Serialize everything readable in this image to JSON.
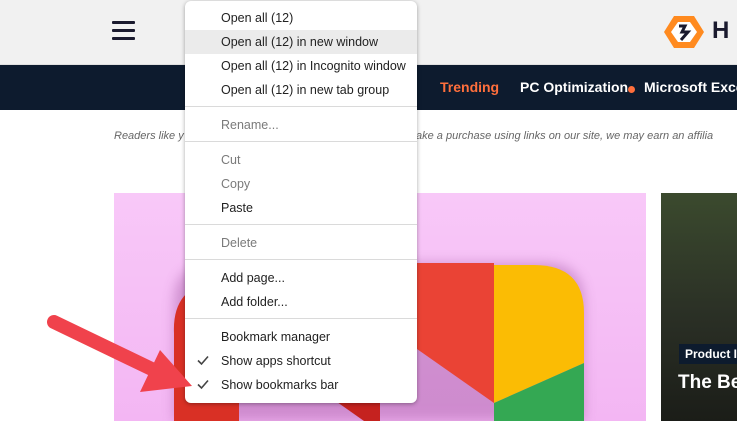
{
  "site": {
    "logo_text": "H",
    "nav": {
      "trending": "Trending",
      "pc_optimization": "PC Optimization",
      "microsoft_excel": "Microsoft Exce"
    },
    "disclaimer_left": "Readers like y",
    "disclaimer_right": "ake a purchase using links on our site, we may earn an affilia",
    "side_card": {
      "badge": "Product I",
      "title": "The Be"
    }
  },
  "context_menu": {
    "items": [
      {
        "label": "Open all (12)"
      },
      {
        "label": "Open all (12) in new window",
        "highlighted": true
      },
      {
        "label": "Open all (12) in Incognito window"
      },
      {
        "label": "Open all (12) in new tab group"
      },
      {
        "label": "Rename...",
        "disabled": true
      },
      {
        "label": "Cut",
        "disabled": true
      },
      {
        "label": "Copy",
        "disabled": true
      },
      {
        "label": "Paste"
      },
      {
        "label": "Delete",
        "disabled": true
      },
      {
        "label": "Add page..."
      },
      {
        "label": "Add folder..."
      },
      {
        "label": "Bookmark manager"
      },
      {
        "label": "Show apps shortcut",
        "checked": true
      },
      {
        "label": "Show bookmarks bar",
        "checked": true
      }
    ]
  },
  "colors": {
    "accent": "#ff6f3c",
    "navbar": "#0d1b2e",
    "arrow": "#f0424c",
    "hero_bg": "#f3b6f3"
  }
}
